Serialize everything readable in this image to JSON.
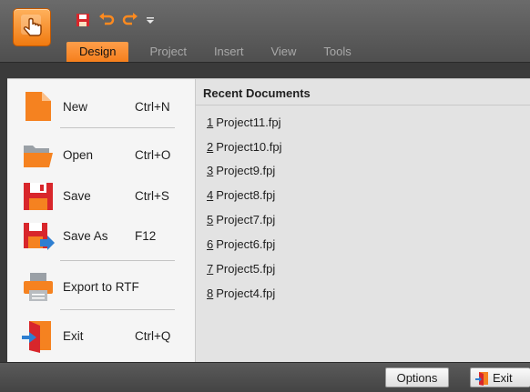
{
  "quick_access": {
    "save_icon": "save-icon",
    "undo_icon": "undo-icon",
    "redo_icon": "redo-icon",
    "customize_icon": "dropdown-arrow-icon"
  },
  "tabs": [
    {
      "label": "Design",
      "active": true
    },
    {
      "label": "Project",
      "active": false
    },
    {
      "label": "Insert",
      "active": false
    },
    {
      "label": "View",
      "active": false
    },
    {
      "label": "Tools",
      "active": false
    }
  ],
  "menu": {
    "new": {
      "label": "New",
      "shortcut": "Ctrl+N"
    },
    "open": {
      "label": "Open",
      "shortcut": "Ctrl+O"
    },
    "save": {
      "label": "Save",
      "shortcut": "Ctrl+S"
    },
    "save_as": {
      "label": "Save As",
      "shortcut": "F12"
    },
    "export": {
      "label": "Export to RTF",
      "shortcut": ""
    },
    "exit": {
      "label": "Exit",
      "shortcut": "Ctrl+Q"
    }
  },
  "recent": {
    "header": "Recent Documents",
    "items": [
      {
        "num": "1",
        "name": "Project11.fpj"
      },
      {
        "num": "2",
        "name": "Project10.fpj"
      },
      {
        "num": "3",
        "name": "Project9.fpj"
      },
      {
        "num": "4",
        "name": "Project8.fpj"
      },
      {
        "num": "5",
        "name": "Project7.fpj"
      },
      {
        "num": "6",
        "name": "Project6.fpj"
      },
      {
        "num": "7",
        "name": "Project5.fpj"
      },
      {
        "num": "8",
        "name": "Project4.fpj"
      }
    ]
  },
  "bottom": {
    "options_label": "Options",
    "exit_label": "Exit"
  },
  "colors": {
    "accent_orange": "#f57f1c",
    "save_red": "#d8262b",
    "frame_dark": "#3a3a3a"
  }
}
